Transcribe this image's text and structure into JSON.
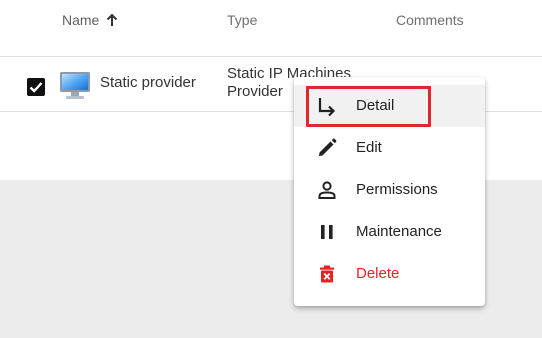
{
  "table": {
    "columns": {
      "name": "Name",
      "type": "Type",
      "comments": "Comments"
    },
    "sort_icon": "arrow-up-icon",
    "rows": [
      {
        "checked": true,
        "icon": "monitor-icon",
        "name": "Static provider",
        "type_line1": "Static IP Machines",
        "type_line2": "Provider"
      }
    ]
  },
  "context_menu": {
    "items": [
      {
        "label": "Detail",
        "icon": "detail-arrow-icon"
      },
      {
        "label": "Edit",
        "icon": "pencil-icon"
      },
      {
        "label": "Permissions",
        "icon": "person-icon"
      },
      {
        "label": "Maintenance",
        "icon": "pause-icon"
      },
      {
        "label": "Delete",
        "icon": "trash-icon"
      }
    ]
  },
  "colors": {
    "highlight": "#e0262f",
    "danger": "#e52323"
  }
}
